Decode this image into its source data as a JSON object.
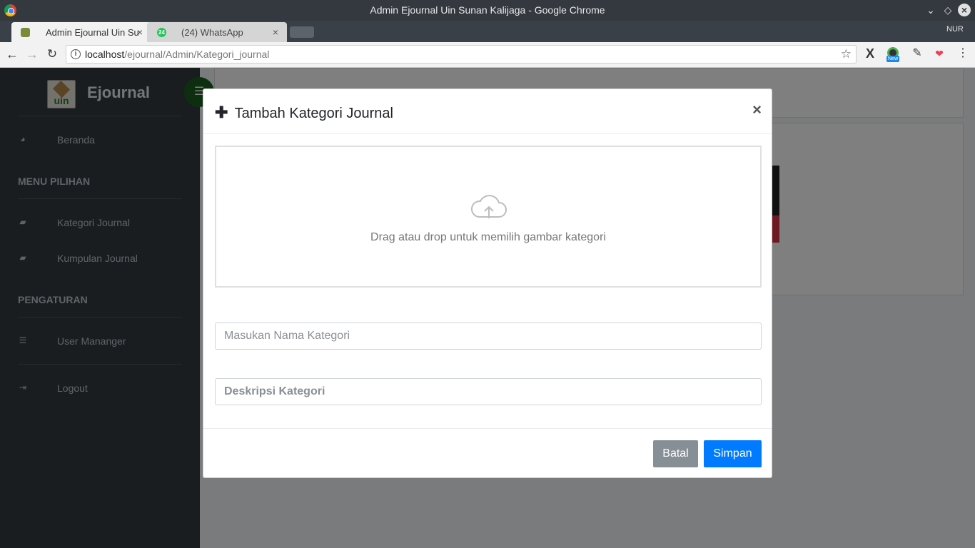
{
  "window": {
    "title": "Admin Ejournal Uin Sunan Kalijaga - Google Chrome"
  },
  "tabs": [
    {
      "label": "Admin Ejournal Uin Su",
      "active": true
    },
    {
      "label": "(24) WhatsApp",
      "badge": "24",
      "active": false
    }
  ],
  "profile": "NUR",
  "address": {
    "host": "localhost",
    "path": "/ejournal/Admin/Kategori_journal"
  },
  "extensions": {
    "new_badge": "New"
  },
  "sidebar": {
    "brand": "Ejournal",
    "logo_text": "uin",
    "items": [
      {
        "label": "Beranda",
        "icon": "dashboard-icon"
      },
      {
        "label": "Kategori Journal",
        "icon": "book-icon"
      },
      {
        "label": "Kumpulan Journal",
        "icon": "book-icon"
      },
      {
        "label": "User Mananger",
        "icon": "list-icon"
      },
      {
        "label": "Logout",
        "icon": "sign-out-icon"
      }
    ],
    "sections": [
      "MENU PILIHAN",
      "PENGATURAN"
    ]
  },
  "modal": {
    "title": "Tambah Kategori Journal",
    "close": "×",
    "dropzone_text": "Drag atau drop untuk memilih gambar kategori",
    "nama_placeholder": "Masukan Nama Kategori",
    "deskripsi_placeholder": "Deskripsi Kategori",
    "batal": "Batal",
    "simpan": "Simpan"
  },
  "colors": {
    "primary": "#007bff",
    "secondary": "#868e96",
    "sidebar": "#343a40",
    "danger": "#dc3545"
  }
}
